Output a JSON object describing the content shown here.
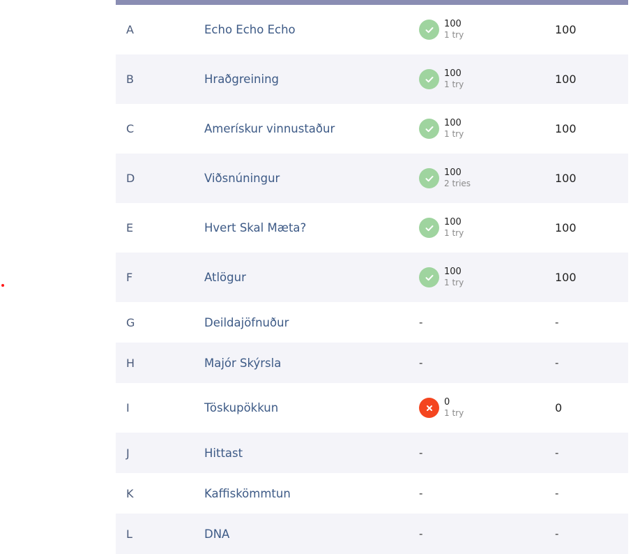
{
  "problems": [
    {
      "letter": "A",
      "name": "Echo Echo Echo",
      "status": "ok",
      "score": "100",
      "tries": "1 try",
      "total": "100"
    },
    {
      "letter": "B",
      "name": "Hraðgreining",
      "status": "ok",
      "score": "100",
      "tries": "1 try",
      "total": "100"
    },
    {
      "letter": "C",
      "name": "Amerískur vinnustaður",
      "status": "ok",
      "score": "100",
      "tries": "1 try",
      "total": "100"
    },
    {
      "letter": "D",
      "name": "Viðsnúningur",
      "status": "ok",
      "score": "100",
      "tries": "2 tries",
      "total": "100"
    },
    {
      "letter": "E",
      "name": "Hvert Skal Mæta?",
      "status": "ok",
      "score": "100",
      "tries": "1 try",
      "total": "100"
    },
    {
      "letter": "F",
      "name": "Atlögur",
      "status": "ok",
      "score": "100",
      "tries": "1 try",
      "total": "100"
    },
    {
      "letter": "G",
      "name": "Deildajöfnuður",
      "status": "none",
      "score": "-",
      "tries": "",
      "total": "-"
    },
    {
      "letter": "H",
      "name": "Majór Skýrsla",
      "status": "none",
      "score": "-",
      "tries": "",
      "total": "-"
    },
    {
      "letter": "I",
      "name": "Töskupökkun",
      "status": "fail",
      "score": "0",
      "tries": "1 try",
      "total": "0"
    },
    {
      "letter": "J",
      "name": "Hittast",
      "status": "none",
      "score": "-",
      "tries": "",
      "total": "-"
    },
    {
      "letter": "K",
      "name": "Kaffiskömmtun",
      "status": "none",
      "score": "-",
      "tries": "",
      "total": "-"
    },
    {
      "letter": "L",
      "name": "DNA",
      "status": "none",
      "score": "-",
      "tries": "",
      "total": "-"
    }
  ],
  "colors": {
    "header_bar": "#8a8db3",
    "accepted": "#9fd49f",
    "rejected": "#f4451f",
    "link": "#3d5a86"
  },
  "icons": {
    "accepted": "check-icon",
    "rejected": "x-icon"
  }
}
